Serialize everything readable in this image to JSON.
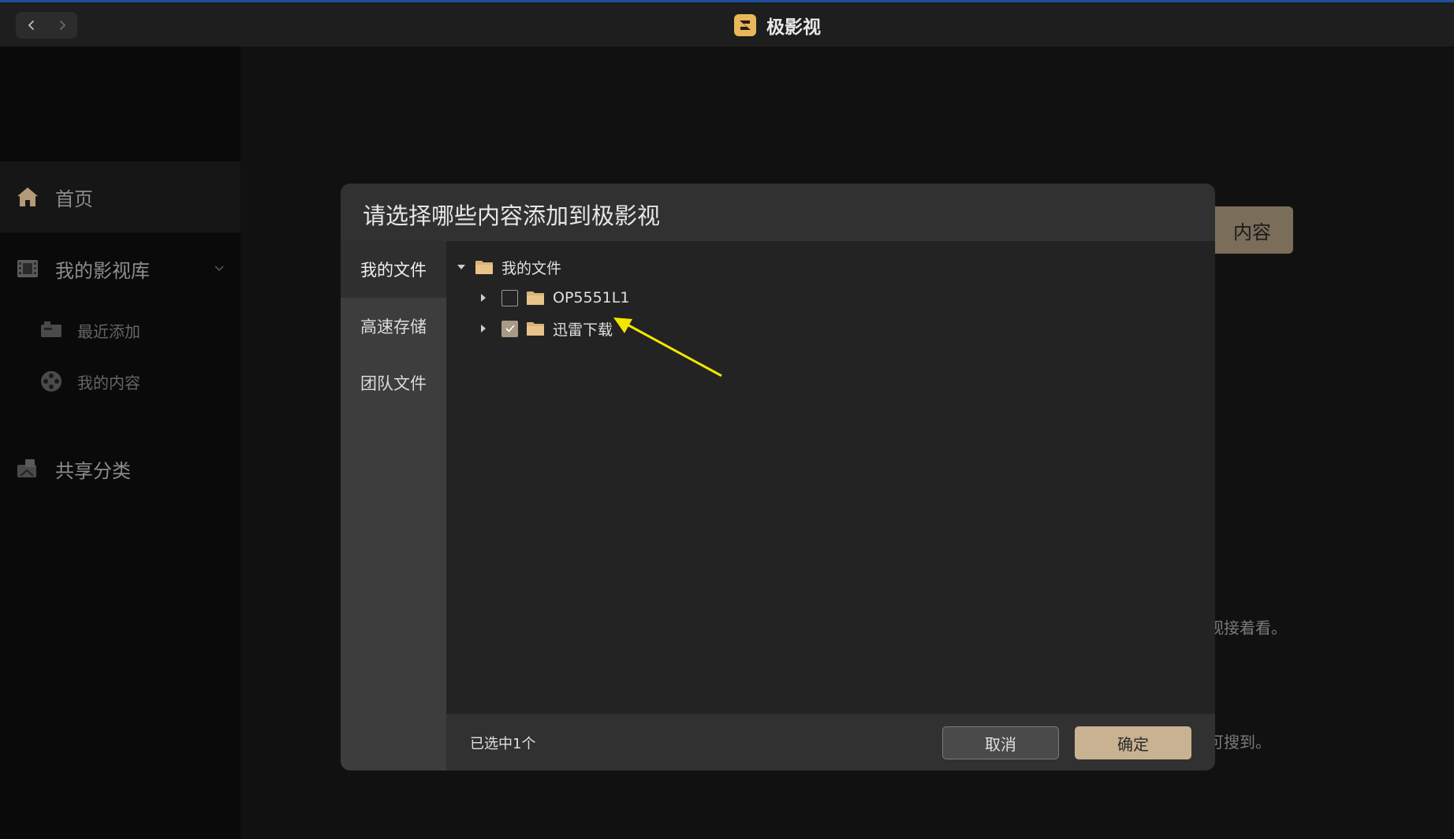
{
  "app": {
    "title": "极影视"
  },
  "sidebar": {
    "home": "首页",
    "library": "我的影视库",
    "recent": "最近添加",
    "my_content": "我的内容",
    "shared": "共享分类"
  },
  "background": {
    "button_label": "内容",
    "text1": "观接着看。",
    "text2": "可搜到。"
  },
  "modal": {
    "title": "请选择哪些内容添加到极影视",
    "tabs": [
      {
        "label": "我的文件",
        "active": true
      },
      {
        "label": "高速存储",
        "active": false
      },
      {
        "label": "团队文件",
        "active": false
      }
    ],
    "tree": {
      "root": "我的文件",
      "children": [
        {
          "label": "OP5551L1",
          "checked": false
        },
        {
          "label": "迅雷下载",
          "checked": true
        }
      ]
    },
    "footer": {
      "selected_count": "已选中1个",
      "cancel": "取消",
      "confirm": "确定"
    }
  },
  "colors": {
    "accent": "#c8b292",
    "annotation": "#f2e600"
  }
}
